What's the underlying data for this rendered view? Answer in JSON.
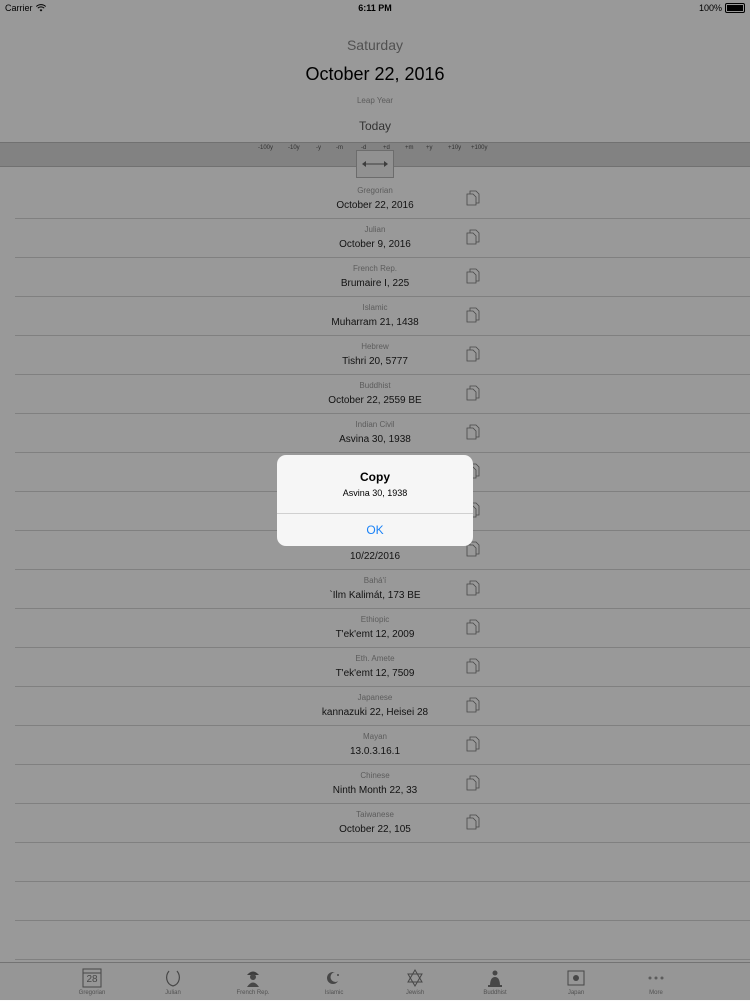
{
  "status_bar": {
    "carrier": "Carrier",
    "time": "6:11 PM",
    "battery": "100%"
  },
  "header": {
    "weekday": "Saturday",
    "date": "October 22, 2016",
    "leap": "Leap Year",
    "today_button": "Today"
  },
  "scale": {
    "labels": [
      "-100y",
      "-10y",
      "-y",
      "-m",
      "-d",
      "+d",
      "+m",
      "+y",
      "+10y",
      "+100y"
    ]
  },
  "calendars": [
    {
      "name": "Gregorian",
      "value": "October 22, 2016"
    },
    {
      "name": "Julian",
      "value": "October 9, 2016"
    },
    {
      "name": "French Rep.",
      "value": "Brumaire I, 225"
    },
    {
      "name": "Islamic",
      "value": "Muharram 21, 1438"
    },
    {
      "name": "Hebrew",
      "value": "Tishri 20, 5777"
    },
    {
      "name": "Buddhist",
      "value": "October 22, 2559 BE"
    },
    {
      "name": "Indian Civil",
      "value": "Asvina 30, 1938"
    },
    {
      "name": "",
      "value": ""
    },
    {
      "name": "",
      "value": ""
    },
    {
      "name": "",
      "value": "10/22/2016"
    },
    {
      "name": "Bahá'í",
      "value": "`Ilm Kalimát, 173 BE"
    },
    {
      "name": "Ethiopic",
      "value": "T'ek'emt 12, 2009"
    },
    {
      "name": "Eth. Amete",
      "value": "T'ek'emt 12, 7509"
    },
    {
      "name": "Japanese",
      "value": "kannazuki 22, Heisei 28"
    },
    {
      "name": "Mayan",
      "value": "13.0.3.16.1"
    },
    {
      "name": "Chinese",
      "value": "Ninth Month 22, 33"
    },
    {
      "name": "Taiwanese",
      "value": "October 22, 105"
    }
  ],
  "tabs": [
    {
      "label": "Gregorian",
      "icon": "calendar-icon",
      "day": "28"
    },
    {
      "label": "Julian",
      "icon": "laurel-icon"
    },
    {
      "label": "French Rep.",
      "icon": "bust-icon"
    },
    {
      "label": "Islamic",
      "icon": "crescent-icon"
    },
    {
      "label": "Jewish",
      "icon": "star-of-david-icon"
    },
    {
      "label": "Buddhist",
      "icon": "buddha-icon"
    },
    {
      "label": "Japan",
      "icon": "japan-flag-icon"
    },
    {
      "label": "More",
      "icon": "more-icon"
    }
  ],
  "alert": {
    "title": "Copy",
    "message": "Asvina 30, 1938",
    "ok_label": "OK"
  },
  "colors": {
    "accent": "#1a82f7",
    "overlay": "rgba(0,0,0,0.4)"
  }
}
